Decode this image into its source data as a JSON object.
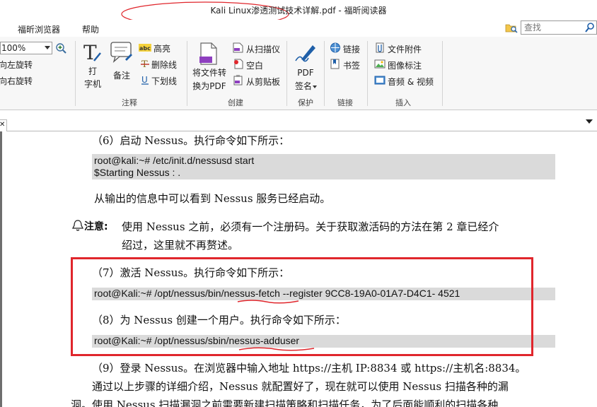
{
  "window": {
    "title": "Kali Linux渗透测试技术详解.pdf - 福昕阅读器"
  },
  "menu": {
    "items": [
      "福昕浏览器",
      "帮助"
    ]
  },
  "search": {
    "placeholder": "查找"
  },
  "ribbon": {
    "zoom_value": "100%",
    "rotate_left": "向左旋转",
    "rotate_right": "向右旋转",
    "typewriter_line1": "打",
    "typewriter_line2": "字机",
    "note": "备注",
    "highlight": "高亮",
    "strikeout": "删除线",
    "underline": "下划线",
    "group_annotate": "注释",
    "convert_line1": "将文件转",
    "convert_line2": "换为PDF",
    "from_scanner": "从扫描仪",
    "blank": "空白",
    "from_clipboard": "从剪贴板",
    "group_create": "创建",
    "sign_line1": "PDF",
    "sign_line2": "签名",
    "group_protect": "保护",
    "link": "链接",
    "bookmark": "书签",
    "group_links": "链接",
    "file_attachment": "文件附件",
    "image_annotation": "图像标注",
    "audio_video": "音频 & 视频",
    "group_insert": "插入",
    "colors": {
      "accent": "#1f5fa8",
      "red_annotation": "#e0262c"
    }
  },
  "document": {
    "step6": "（6）启动 Nessus。执行命令如下所示：",
    "code1_line1": "root@kali:~# /etc/init.d/nessusd start",
    "code1_line2": "$Starting Nessus : .",
    "started": "从输出的信息中可以看到 Nessus 服务已经启动。",
    "note_label": "注意:",
    "note_line1": "使用 Nessus 之前，必须有一个注册码。关于获取激活码的方法在第 2 章已经介",
    "note_line2": "绍过，这里就不再赘述。",
    "step7": "（7）激活 Nessus。执行命令如下所示：",
    "code2": "root@Kali:~# /opt/nessus/bin/nessus-fetch --register 9CC8-19A0-01A7-D4C1- 4521",
    "step8": "（8）为 Nessus 创建一个用户。执行命令如下所示：",
    "code3": "root@Kali:~# /opt/nessus/sbin/nessus-adduser",
    "step9": "（9）登录 Nessus。在浏览器中输入地址 https://主机 IP:8834 或 https://主机名:8834。",
    "summary_line1": "通过以上步骤的详细介绍，Nessus 就配置好了，现在就可以使用 Nessus 扫描各种的漏",
    "summary_line2": "洞。使用 Nessus 扫描漏洞之前需要新建扫描策略和扫描任务，为了后面能顺利的扫描各种"
  }
}
